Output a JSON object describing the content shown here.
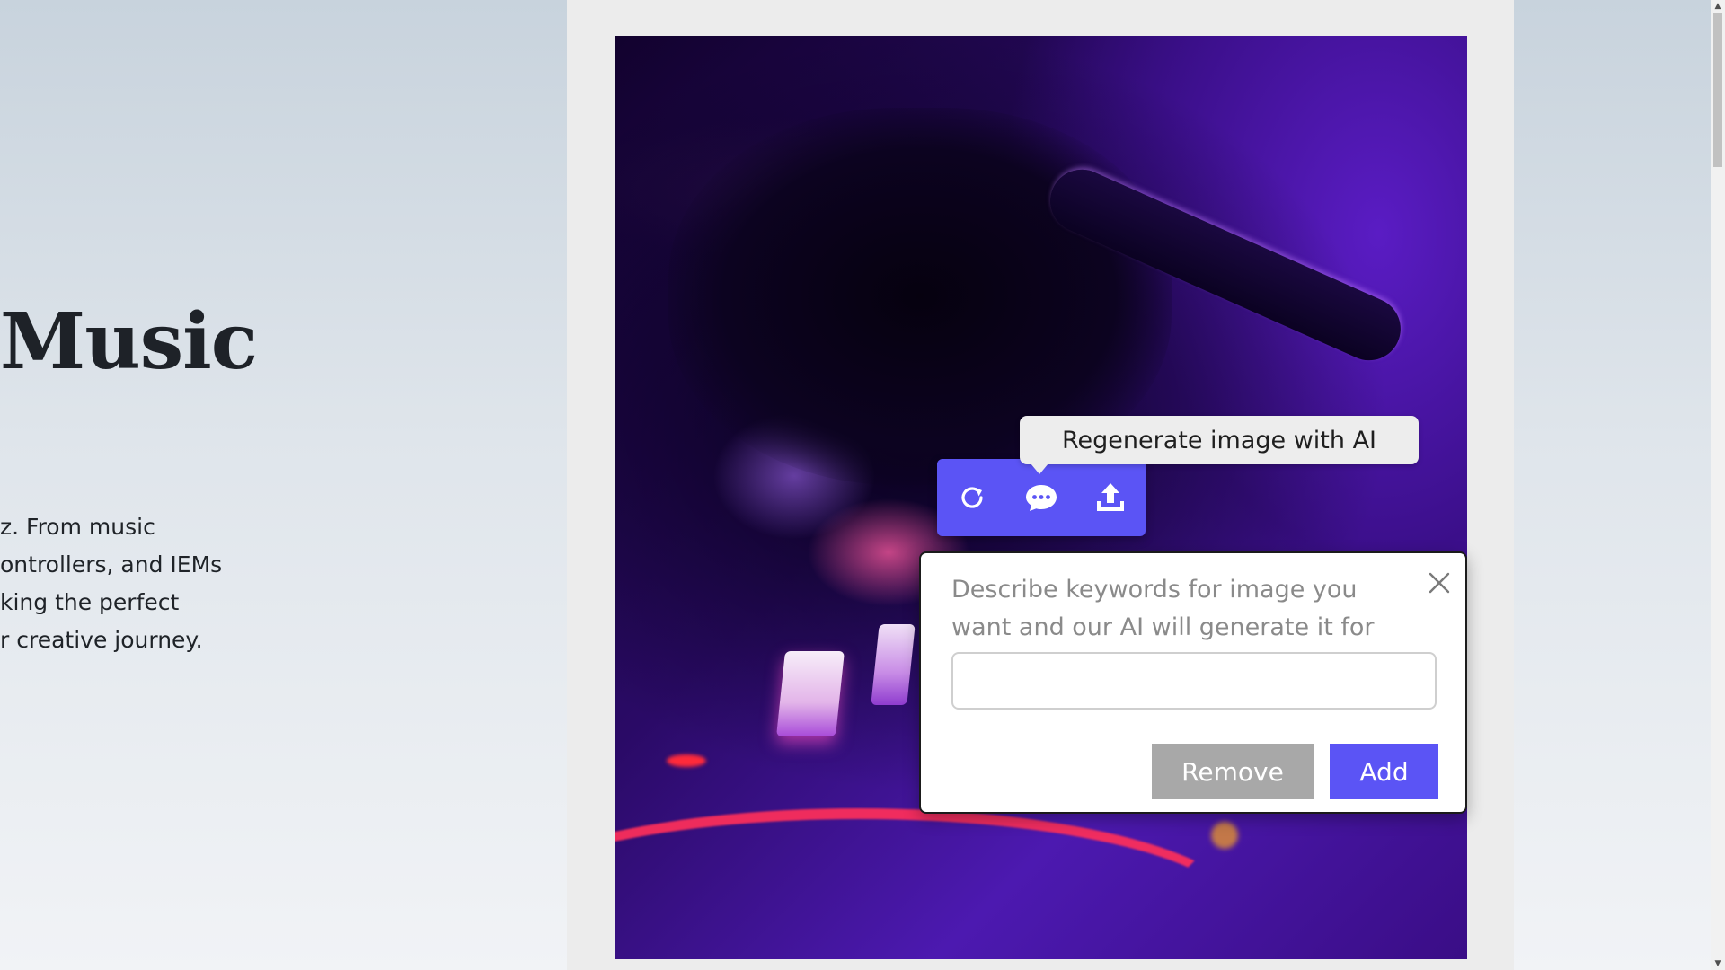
{
  "hero": {
    "title": "Music",
    "description_lines": [
      "z. From music",
      "ontrollers, and IEMs",
      "king the perfect",
      "r creative journey."
    ]
  },
  "toolbar": {
    "buttons": [
      {
        "name": "regenerate",
        "icon": "refresh-icon"
      },
      {
        "name": "ai-chat",
        "icon": "chat-bubble-icon"
      },
      {
        "name": "upload",
        "icon": "upload-icon"
      }
    ],
    "accent_color": "#5b54f5"
  },
  "tooltip": {
    "text": "Regenerate image with AI"
  },
  "ai_dialog": {
    "prompt_text": "Describe keywords for image you want and our AI will generate it for you",
    "input_value": "",
    "remove_label": "Remove",
    "add_label": "Add",
    "remove_color": "#a8a8a8",
    "add_color": "#5b54f5"
  },
  "image": {
    "subject": "dj-mixer-hand-purple"
  }
}
